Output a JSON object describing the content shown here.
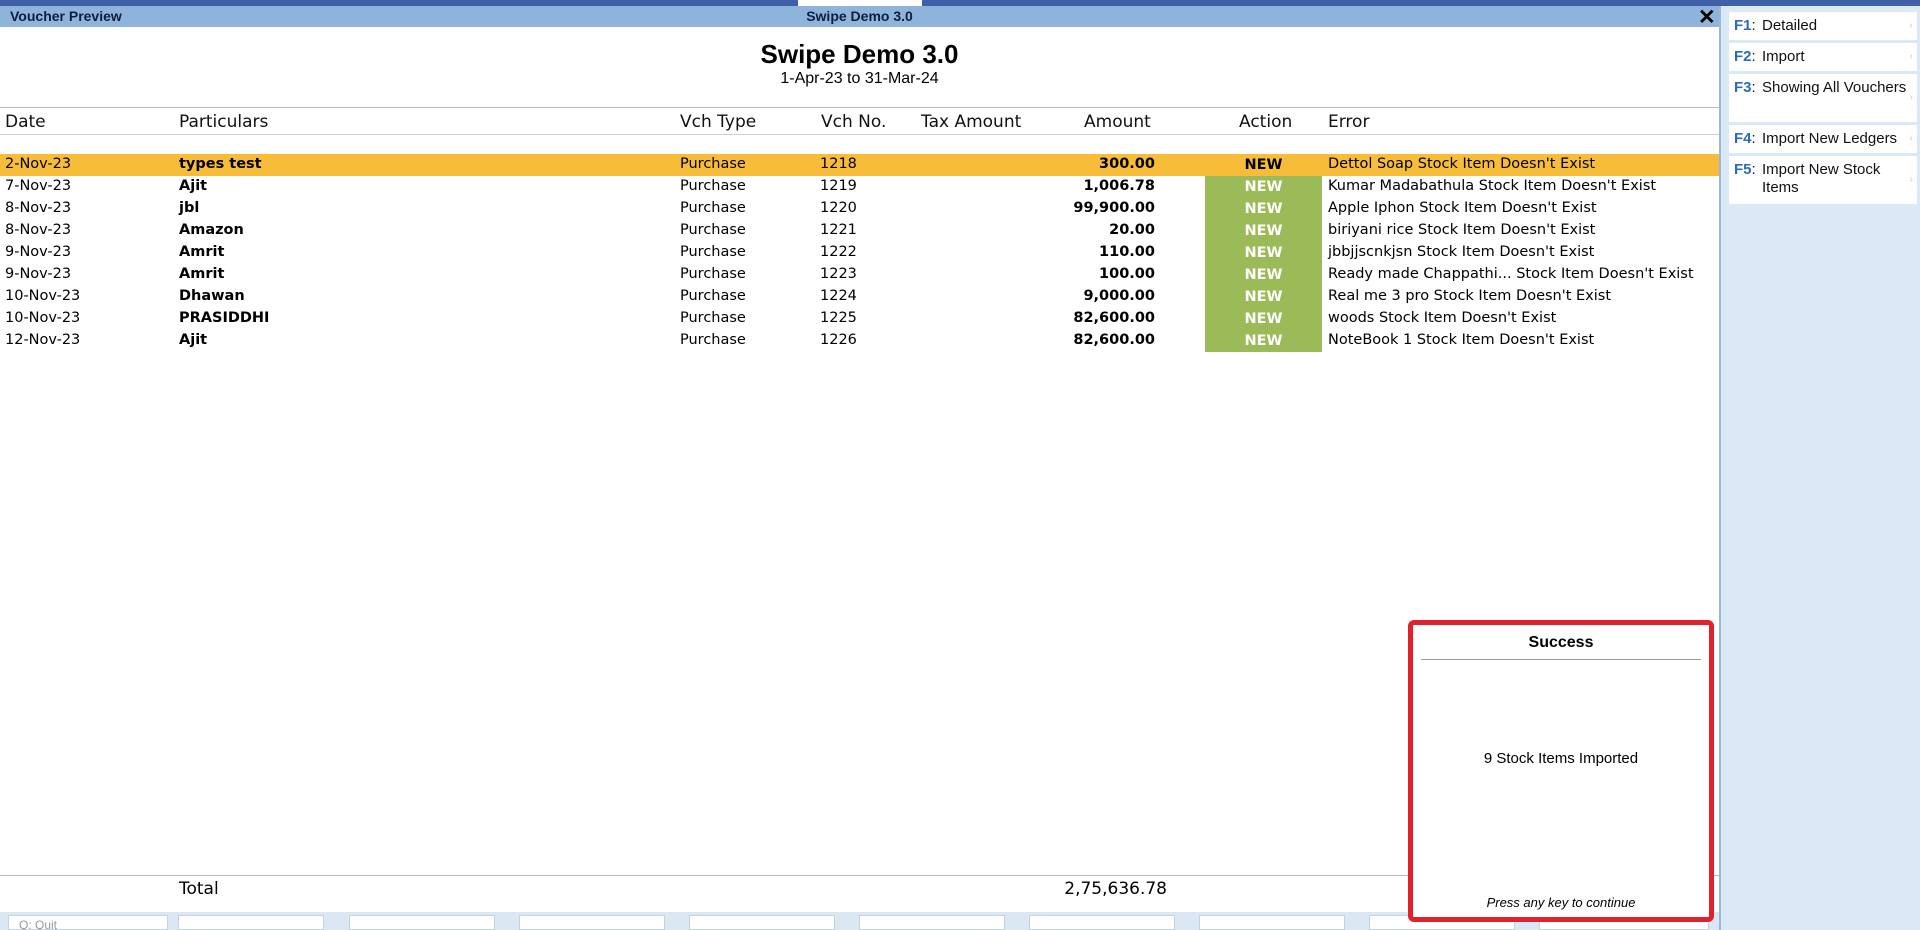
{
  "window": {
    "title": "Voucher Preview",
    "center_title": "Swipe Demo 3.0",
    "close_glyph": "✕"
  },
  "report": {
    "company": "Swipe Demo 3.0",
    "period": "1-Apr-23 to 31-Mar-24"
  },
  "columns": {
    "date": "Date",
    "particulars": "Particulars",
    "vch_type": "Vch Type",
    "vch_no": "Vch No.",
    "tax_amount": "Tax Amount",
    "amount": "Amount",
    "action": "Action",
    "error": "Error"
  },
  "rows": [
    {
      "date": "2-Nov-23",
      "particulars": "types test",
      "vch_type": "Purchase",
      "vch_no": "1218",
      "amount": "300.00",
      "action": "NEW",
      "error": "Dettol Soap Stock Item Doesn't Exist",
      "selected": true
    },
    {
      "date": "7-Nov-23",
      "particulars": "Ajit",
      "vch_type": "Purchase",
      "vch_no": "1219",
      "amount": "1,006.78",
      "action": "NEW",
      "error": "Kumar Madabathula Stock Item Doesn't Exist"
    },
    {
      "date": "8-Nov-23",
      "particulars": "jbl",
      "vch_type": "Purchase",
      "vch_no": "1220",
      "amount": "99,900.00",
      "action": "NEW",
      "error": "Apple Iphon Stock Item Doesn't Exist"
    },
    {
      "date": "8-Nov-23",
      "particulars": "Amazon",
      "vch_type": "Purchase",
      "vch_no": "1221",
      "amount": "20.00",
      "action": "NEW",
      "error": "biriyani rice Stock Item Doesn't Exist"
    },
    {
      "date": "9-Nov-23",
      "particulars": "Amrit",
      "vch_type": "Purchase",
      "vch_no": "1222",
      "amount": "110.00",
      "action": "NEW",
      "error": "jbbjjscnkjsn Stock Item Doesn't Exist"
    },
    {
      "date": "9-Nov-23",
      "particulars": "Amrit",
      "vch_type": "Purchase",
      "vch_no": "1223",
      "amount": "100.00",
      "action": "NEW",
      "error": "Ready made Chappathi... Stock Item Doesn't Exist"
    },
    {
      "date": "10-Nov-23",
      "particulars": "Dhawan",
      "vch_type": "Purchase",
      "vch_no": "1224",
      "amount": "9,000.00",
      "action": "NEW",
      "error": "Real me 3 pro Stock Item Doesn't Exist"
    },
    {
      "date": "10-Nov-23",
      "particulars": "PRASIDDHI",
      "vch_type": "Purchase",
      "vch_no": "1225",
      "amount": "82,600.00",
      "action": "NEW",
      "error": "woods Stock Item Doesn't Exist"
    },
    {
      "date": "12-Nov-23",
      "particulars": "Ajit",
      "vch_type": "Purchase",
      "vch_no": "1226",
      "amount": "82,600.00",
      "action": "NEW",
      "error": "NoteBook 1 Stock Item Doesn't Exist"
    }
  ],
  "total": {
    "label": "Total",
    "amount": "2,75,636.78"
  },
  "dialog": {
    "title": "Success",
    "message": "9 Stock Items Imported",
    "hint": "Press any key to continue"
  },
  "sidebar": {
    "buttons": [
      {
        "key": "F1",
        "label": "Detailed"
      },
      {
        "key": "F2",
        "label": "Import"
      },
      {
        "key": "F3",
        "label": "Showing All Vouchers"
      },
      {
        "key": "F4",
        "label": "Import New Ledgers"
      },
      {
        "key": "F5",
        "label": "Import New Stock Items"
      }
    ]
  },
  "bottombar": {
    "quit_label": "Q: Quit"
  },
  "colors": {
    "selected_row": "#f8bd38",
    "action_badge": "#9bbb59",
    "dialog_border": "#e0222d",
    "titlebar": "#8fb4dc"
  }
}
